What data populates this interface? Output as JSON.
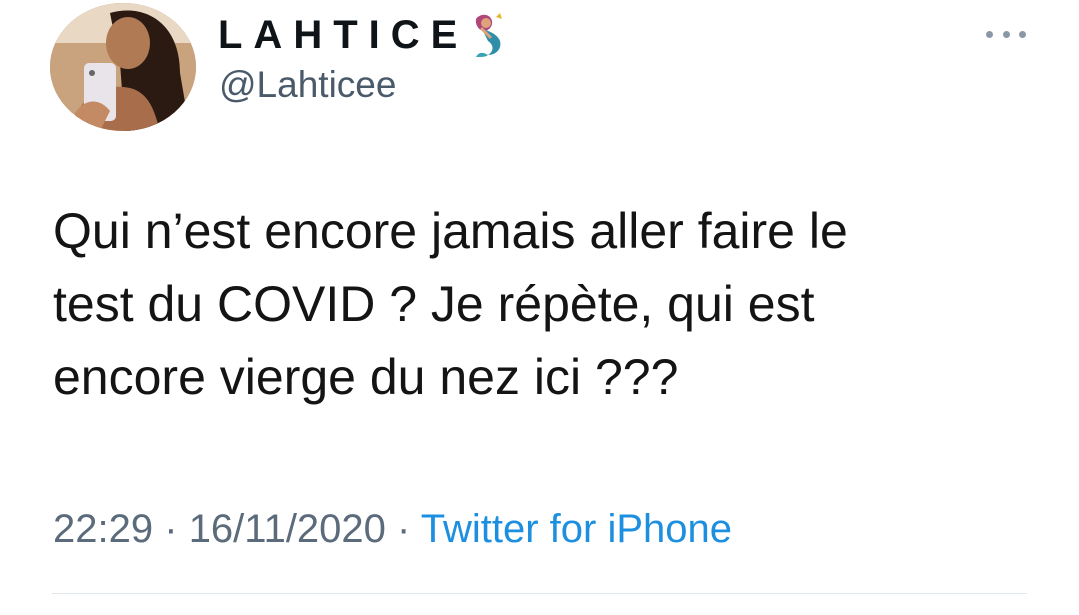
{
  "tweet": {
    "display_name": "LAHTICE",
    "handle": "@Lahticee",
    "text": "Qui n’est encore jamais aller faire le\ntest du COVID ? Je répète, qui est\nencore vierge du nez ici ???",
    "time": "22:29",
    "separator": "·",
    "date": "16/11/2020",
    "source": "Twitter for iPhone"
  },
  "icons": {
    "name_emoji": "mermaid-emoji-icon",
    "more": "more-options-icon"
  },
  "colors": {
    "link": "#1d8fe0",
    "muted": "#5b6b7b",
    "text": "#141414"
  }
}
